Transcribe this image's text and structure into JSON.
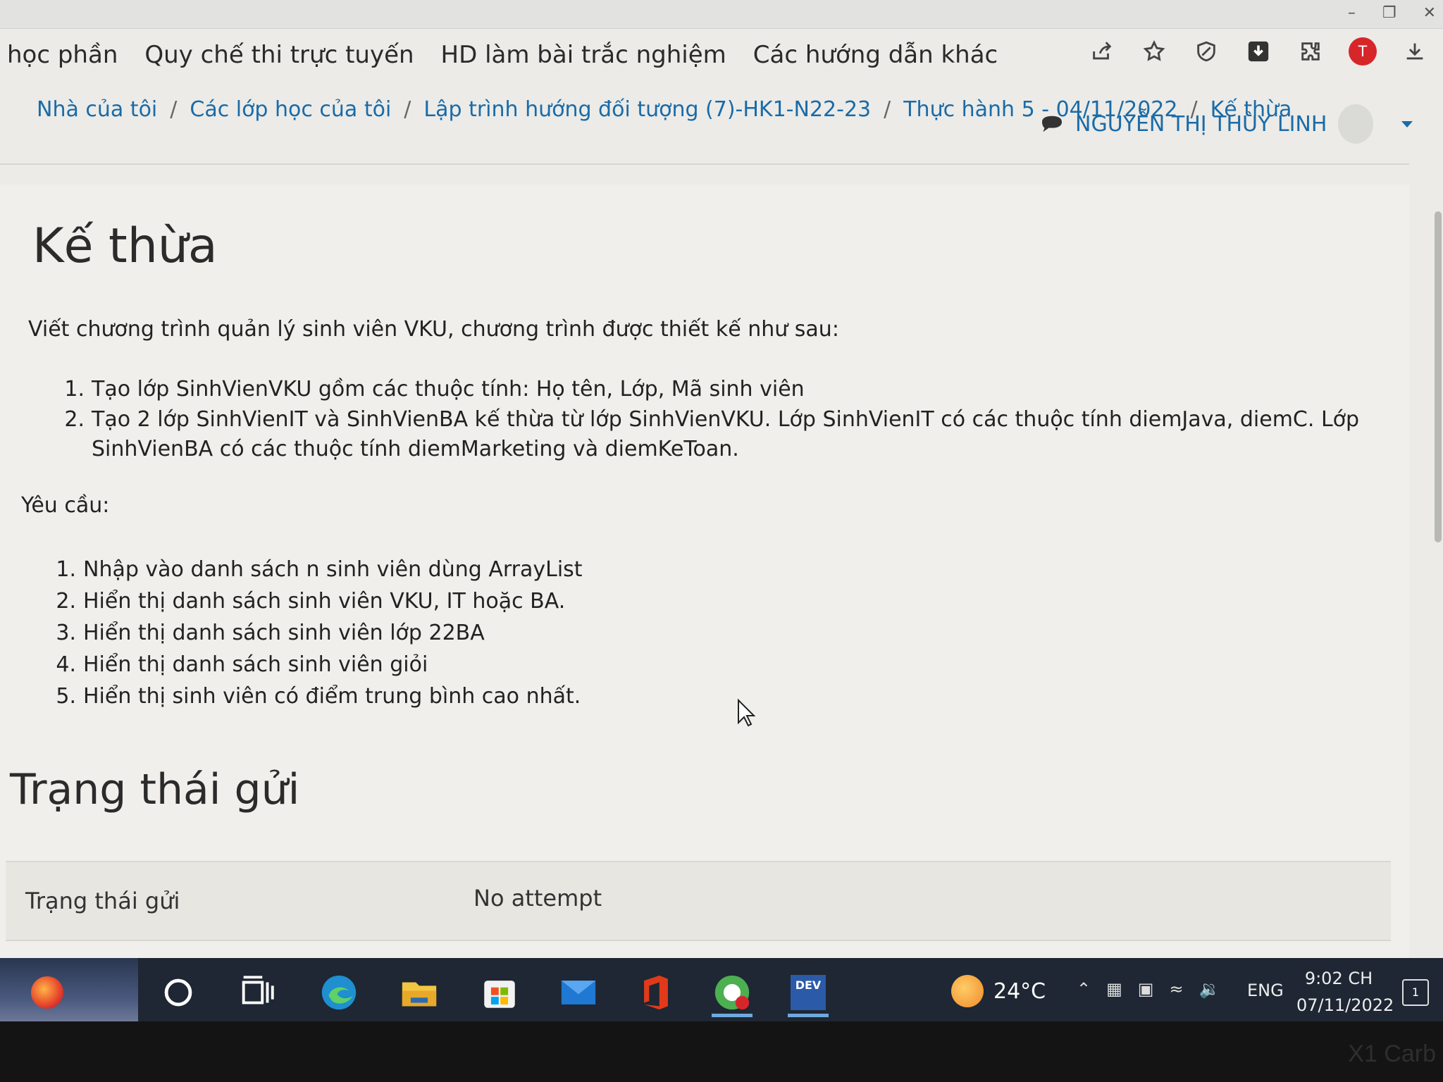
{
  "nav": {
    "items": [
      "học phần",
      "Quy chế thi trực tuyến",
      "HD làm bài trắc nghiệm",
      "Các hướng dẫn khác"
    ]
  },
  "breadcrumb": [
    "Nhà của tôi",
    "Các lớp học của tôi",
    "Lập trình hướng đối tượng (7)-HK1-N22-23",
    "Thực hành 5 - 04/11/2022",
    "Kế thừa"
  ],
  "user": {
    "name": "NGUYỄN THỊ THÙY LINH",
    "avatar_letter": "T"
  },
  "page": {
    "title": "Kế thừa",
    "intro": "Viết chương trình quản lý sinh viên VKU, chương trình được thiết kế như sau:",
    "design_items": [
      {
        "num": "1.",
        "text": "Tạo lớp SinhVienVKU gồm các thuộc tính: Họ tên, Lớp, Mã sinh viên"
      },
      {
        "num": "2.",
        "text": "Tạo 2 lớp SinhVienIT và SinhVienBA kế thừa từ lớp SinhVienVKU. Lớp SinhVienIT có các thuộc tính diemJava, diemC. Lớp SinhVienBA có các thuộc tính diemMarketing và diemKeToan."
      }
    ],
    "requirements_label": "Yêu cầu:",
    "requirements": [
      {
        "num": "1.",
        "text": "Nhập vào danh sách n sinh viên dùng ArrayList"
      },
      {
        "num": "2.",
        "text": "Hiển thị danh sách sinh viên VKU, IT hoặc BA."
      },
      {
        "num": "3.",
        "text": "Hiển thị danh sách sinh viên lớp 22BA"
      },
      {
        "num": "4.",
        "text": "Hiển thị danh sách sinh viên giỏi"
      },
      {
        "num": "5.",
        "text": "Hiển thị sinh viên có điểm trung bình cao nhất."
      }
    ],
    "status_heading": "Trạng thái gửi",
    "status_row": {
      "label": "Trạng thái gửi",
      "value": "No attempt"
    }
  },
  "taskbar": {
    "temperature": "24°C",
    "language": "ENG",
    "time": "9:02 CH",
    "date": "07/11/2022",
    "notification_count": "1",
    "dev_label": "DEV"
  },
  "bezel_text": "X1 Carb",
  "colors": {
    "link": "#1a6ba8",
    "background": "#ecebe7",
    "taskbar": "#1e2733",
    "avatar": "#d7262a"
  }
}
